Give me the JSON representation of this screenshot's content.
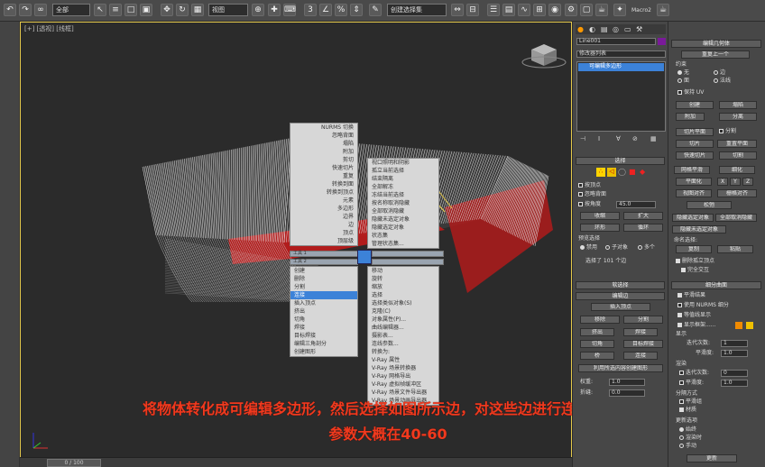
{
  "toolbar": {
    "selection_filter": "全部",
    "ref_coord": "视图",
    "named_selection": "创建选择集",
    "macro_label": "Macro2"
  },
  "viewport": {
    "label": "[+] [透视] [线框]",
    "quad_menu_left": [
      "NURMS 切换",
      "忽略背面",
      "塌陷",
      "附加",
      "剪切",
      "快速切片",
      "重复",
      "转换到面",
      "转换到顶点",
      "元素",
      "多边形",
      "边界",
      "边",
      "顶点",
      "顶层级"
    ],
    "quad_menu_left_tools": [
      "创建",
      "删除",
      "分割",
      "连接",
      "插入顶点",
      "挤出",
      "切角",
      "焊接",
      "目标焊接",
      "编辑三角剖分",
      "创建图形"
    ],
    "quad_menu_right": [
      "视口照明和阴影",
      "孤立当前选择",
      "结束隔离",
      "全部解冻",
      "冻结当前选择",
      "按名称取消隐藏",
      "全部取消隐藏",
      "隐藏未选定对象",
      "隐藏选定对象",
      "状态集",
      "管理状态集..."
    ],
    "quad_menu_right_tools": [
      "移动",
      "旋转",
      "缩放",
      "选择",
      "选择类似对象(S)",
      "克隆(C)",
      "对象属性(P)...",
      "曲线编辑器...",
      "摄影表...",
      "连线参数...",
      "转换为:",
      "V-Ray 属性",
      "V-Ray 场景转换器",
      "V-Ray 网格导出",
      "V-Ray 虚拟帧缓冲区",
      "V-Ray 场景文件导出器",
      "V-Ray 场景动画导出器"
    ],
    "quad_bar_1": "工具 1",
    "quad_bar_2": "工具 2",
    "highlighted": "连接",
    "timeline": "0 / 100",
    "caption_line1": "将物体转化成可编辑多边形，然后选择如图所示边，对这些边进行连接命令，",
    "caption_line2": "参数大概在40-60"
  },
  "command_panel": {
    "object_name": "Line001",
    "modifier_list": "修改器列表",
    "stack_item": "可编辑多边形",
    "selection_title": "选择",
    "by_vertex": "按顶点",
    "ignore_backfacing": "忽略背面",
    "by_angle": "按角度",
    "angle_value": "45.0",
    "shrink": "收缩",
    "grow": "扩大",
    "ring": "环形",
    "loop": "循环",
    "preview_selection": "预览选择",
    "preview_off": "禁用",
    "preview_subobj": "子对象",
    "preview_multi": "多个",
    "selected_count": "选择了 101 个边",
    "soft_selection": "软选择",
    "edit_edges": "编辑边",
    "insert_vertex": "插入顶点",
    "remove": "移除",
    "split": "分割",
    "extrude": "挤出",
    "weld": "焊接",
    "chamfer": "切角",
    "target_weld": "目标焊接",
    "bridge": "桥",
    "connect": "连接",
    "create_shape": "利用所选内容创建图形",
    "weight_label": "权重:",
    "weight_value": "1.0",
    "crease_label": "折缝:",
    "crease_value": "0.0"
  },
  "edit_geometry": {
    "title": "编辑几何体",
    "repeat_last": "重复上一个",
    "constraints": "约束",
    "c_none": "无",
    "c_edge": "边",
    "c_face": "面",
    "c_normal": "法线",
    "preserve_uv": "保持 UV",
    "create": "创建",
    "collapse": "塌陷",
    "attach": "附加",
    "detach": "分离",
    "slice_plane": "切片平面",
    "split_cb": "分割",
    "slice": "切片",
    "reset_plane": "重置平面",
    "quickslice": "快速切片",
    "cut": "切割",
    "meshsmooth": "网格平滑",
    "tessellate": "细化",
    "make_planar": "平面化",
    "x": "X",
    "y": "Y",
    "z": "Z",
    "view_align": "视图对齐",
    "grid_align": "栅格对齐",
    "relax": "松弛",
    "hide_selected": "隐藏选定对象",
    "unhide_all": "全部取消隐藏",
    "hide_unselected": "隐藏未选定对象",
    "named_sel": "命名选择:",
    "copy": "复制",
    "paste": "粘贴",
    "delete_isolated": "删除孤立顶点",
    "full_interactivity": "完全交互",
    "subdivision_title": "细分曲面",
    "smooth_result": "平滑结果",
    "use_nurms": "使用 NURMS 细分",
    "isoline": "等值线显示",
    "show_cage": "显示框架......",
    "display": "显示",
    "iterations": "迭代次数:",
    "iter_val": "1",
    "smoothness": "平滑度:",
    "smooth_val": "1.0",
    "render": "渲染",
    "r_iterations": "迭代次数:",
    "r_iter_val": "0",
    "r_smoothness": "平滑度:",
    "r_smooth_val": "1.0",
    "separate_by": "分隔方式",
    "sep_smooth": "平滑组",
    "sep_material": "材质",
    "update_options": "更新选项",
    "always": "始终",
    "when_render": "渲染时",
    "manually": "手动",
    "update_btn": "更新"
  },
  "colors": {
    "accent_yellow": "#e5c94b",
    "highlight_blue": "#3c82d8",
    "caption_red": "#f03a1e",
    "mesh_red": "#c91a1a",
    "wire_white": "#e8e8e8"
  }
}
